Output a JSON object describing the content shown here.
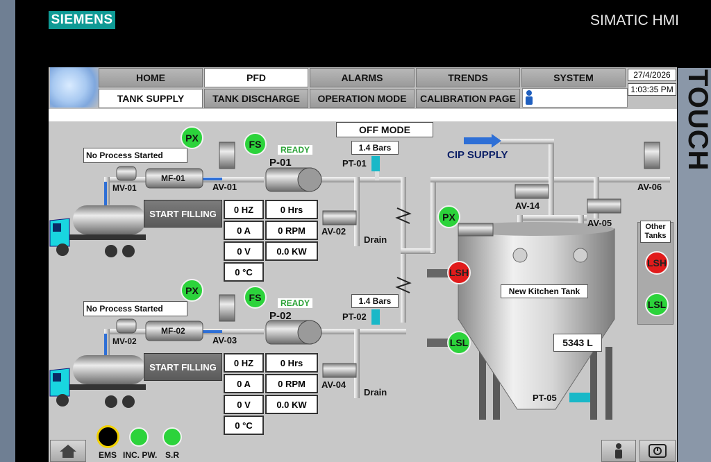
{
  "brand": {
    "left": "SIEMENS",
    "right": "SIMATIC HMI",
    "side": "TOUCH"
  },
  "nav": {
    "row1": [
      "HOME",
      "PFD",
      "ALARMS",
      "TRENDS",
      "SYSTEM"
    ],
    "row2": [
      "TANK SUPPLY",
      "TANK DISCHARGE",
      "OPERATION MODE",
      "CALIBRATION PAGE"
    ],
    "active": "PFD"
  },
  "datetime": {
    "date": "27/4/2026",
    "time": "1:03:35 PM"
  },
  "mode": "OFF MODE",
  "cip": "CIP SUPPLY",
  "line1": {
    "status": "No Process Started",
    "px": "PX",
    "fs": "FS",
    "ready": "READY",
    "pump": "P-01",
    "pressure": "1.4 Bars",
    "pt": "PT-01",
    "mv": "MV-01",
    "mf": "MF-01",
    "av1": "AV-01",
    "av2": "AV-02",
    "drain": "Drain",
    "start": "START FILLING",
    "readings": {
      "hz": "0 HZ",
      "hrs": "0 Hrs",
      "a": "0 A",
      "rpm": "0 RPM",
      "v": "0 V",
      "kw": "0.0 KW",
      "c": "0 °C"
    }
  },
  "line2": {
    "status": "No Process Started",
    "px": "PX",
    "fs": "FS",
    "ready": "READY",
    "pump": "P-02",
    "pressure": "1.4 Bars",
    "pt": "PT-02",
    "mv": "MV-02",
    "mf": "MF-02",
    "av1": "AV-03",
    "av2": "AV-04",
    "drain": "Drain",
    "start": "START FILLING",
    "readings": {
      "hz": "0 HZ",
      "hrs": "0 Hrs",
      "a": "0 A",
      "rpm": "0 RPM",
      "v": "0 V",
      "kw": "0.0 KW",
      "c": "0 °C"
    }
  },
  "tank": {
    "name": "New Kitchen Tank",
    "level": "5343 L",
    "px": "PX",
    "lsh": "LSH",
    "lsl": "LSL",
    "pt": "PT-05",
    "av14": "AV-14",
    "av05": "AV-05",
    "av06": "AV-06"
  },
  "other_tanks": {
    "title": "Other Tanks",
    "lsh": "LSH",
    "lsl": "LSL"
  },
  "status_lamps": {
    "ems": "EMS",
    "inc": "INC. PW.",
    "sr": "S.R"
  },
  "colors": {
    "green": "#2cd33b",
    "red": "#e11b1b",
    "logo": "#0f9a95",
    "truck": "#19d6e0",
    "pipe_blue": "#2e6fd6"
  },
  "icons": [
    "home-icon",
    "user-icon",
    "power-icon",
    "truck-icon",
    "pump-icon",
    "valve-icon",
    "tank-icon",
    "arrow-right-icon"
  ]
}
